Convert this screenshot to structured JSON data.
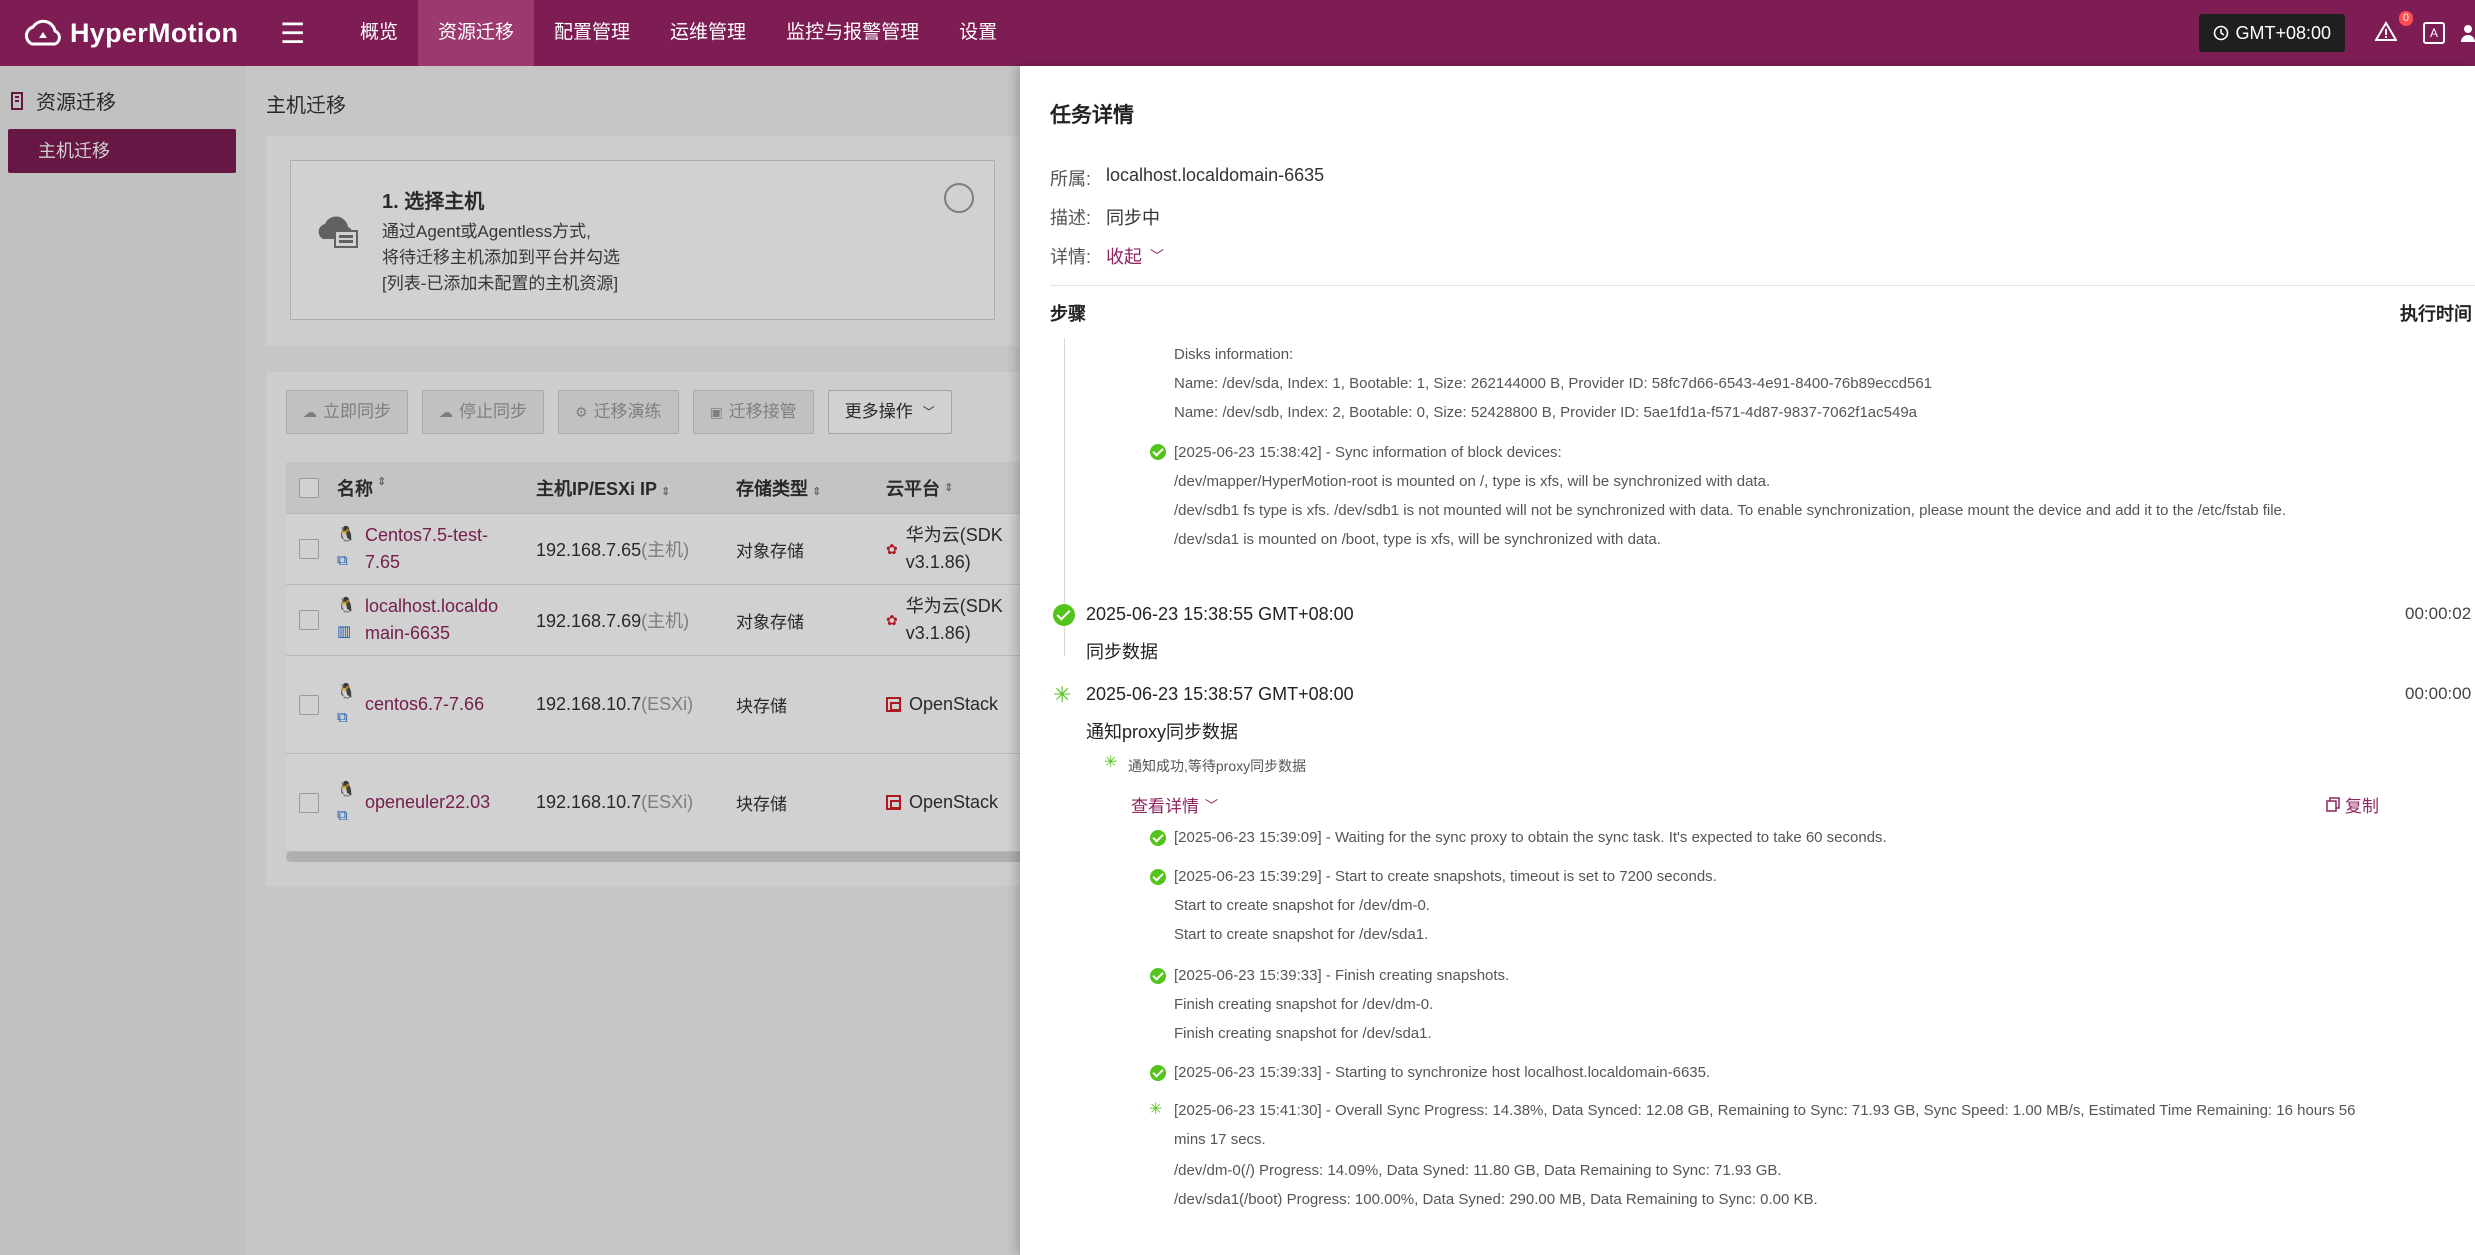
{
  "brand": {
    "name": "HyperMotion",
    "accent": "#7e1d54"
  },
  "nav": {
    "items": [
      "概览",
      "资源迁移",
      "配置管理",
      "运维管理",
      "监控与报警管理",
      "设置"
    ],
    "active": "资源迁移",
    "timezone": "GMT+08:00",
    "alert_count": "0"
  },
  "sidebar": {
    "title": "资源迁移",
    "items": [
      "主机迁移"
    ]
  },
  "page": {
    "title": "主机迁移"
  },
  "step_card": {
    "name": "1. 选择主机",
    "lines": [
      "通过Agent或Agentless方式,",
      "将待迁移主机添加到平台并勾选",
      "[列表-已添加未配置的主机资源]"
    ]
  },
  "toolbar": {
    "sync_now": "立即同步",
    "stop_sync": "停止同步",
    "drill": "迁移演练",
    "takeover": "迁移接管",
    "more": "更多操作"
  },
  "table": {
    "headers": [
      "名称",
      "主机IP/ESXi IP",
      "存储类型",
      "云平台"
    ],
    "rows": [
      {
        "name_1": "Centos7.5-test-",
        "name_2": "7.65",
        "ip": "192.168.7.65",
        "ip_type": "(主机)",
        "storage": "对象存储",
        "cloud_1": "华为云(SDK",
        "cloud_2": "v3.1.86)"
      },
      {
        "name_1": "localhost.localdo",
        "name_2": "main-6635",
        "ip": "192.168.7.69",
        "ip_type": "(主机)",
        "storage": "对象存储",
        "cloud_1": "华为云(SDK",
        "cloud_2": "v3.1.86)"
      },
      {
        "name_1": "centos6.7-7.66",
        "name_2": "",
        "ip": "192.168.10.7",
        "ip_type": "(ESXi)",
        "storage": "块存储",
        "cloud_1": "OpenStack",
        "cloud_2": ""
      },
      {
        "name_1": "openeuler22.03",
        "name_2": "",
        "ip": "192.168.10.7",
        "ip_type": "(ESXi)",
        "storage": "块存储",
        "cloud_1": "OpenStack",
        "cloud_2": ""
      }
    ]
  },
  "drawer": {
    "title": "任务详情",
    "owner_label": "所属:",
    "owner": "localhost.localdomain-6635",
    "desc_label": "描述:",
    "desc": "同步中",
    "detail_label": "详情:",
    "collapse": "收起",
    "steps_header": "步骤",
    "time_header": "执行时间",
    "logs_top": [
      "Disks information:",
      "Name: /dev/sda, Index: 1, Bootable: 1, Size: 262144000 B, Provider ID: 58fc7d66-6543-4e91-8400-76b89eccd561",
      "Name: /dev/sdb, Index: 2, Bootable: 0, Size: 52428800 B, Provider ID: 5ae1fd1a-f571-4d87-9837-7062f1ac549a",
      "[2025-06-23 15:38:42] - Sync information of block devices:",
      "/dev/mapper/HyperMotion-root is mounted on /, type is xfs, will be synchronized with data.",
      "/dev/sdb1 fs type is xfs. /dev/sdb1 is not mounted will not be synchronized with data. To enable synchronization, please mount the device and add it to the /etc/fstab file.",
      "/dev/sda1 is mounted on /boot, type is xfs, will be synchronized with data."
    ],
    "step_sync": {
      "time": "2025-06-23 15:38:55 GMT+08:00",
      "label": "同步数据",
      "duration": "00:00:02"
    },
    "step_proxy": {
      "time": "2025-06-23 15:38:57 GMT+08:00",
      "label": "通知proxy同步数据",
      "duration": "00:00:00",
      "note": "通知成功,等待proxy同步数据"
    },
    "view_detail": "查看详情",
    "copy": "复制",
    "logs_bottom": [
      "[2025-06-23 15:39:09] - Waiting for the sync proxy to obtain the sync task. It's expected to take 60 seconds.",
      "[2025-06-23 15:39:29] - Start to create snapshots, timeout is set to 7200 seconds.",
      "Start to create snapshot for /dev/dm-0.",
      "Start to create snapshot for /dev/sda1.",
      "[2025-06-23 15:39:33] - Finish creating snapshots.",
      "Finish creating snapshot for /dev/dm-0.",
      "Finish creating snapshot for /dev/sda1.",
      "[2025-06-23 15:39:33] - Starting to synchronize host localhost.localdomain-6635.",
      "[2025-06-23 15:41:30] - Overall Sync Progress: 14.38%, Data Synced: 12.08 GB, Remaining to Sync: 71.93 GB, Sync Speed: 1.00 MB/s, Estimated Time Remaining: 16 hours 56 mins 17 secs.",
      "/dev/dm-0(/) Progress: 14.09%, Data Syned: 11.80 GB, Data Remaining to Sync: 71.93 GB.",
      "/dev/sda1(/boot) Progress: 100.00%, Data Syned: 290.00 MB, Data Remaining to Sync: 0.00 KB."
    ]
  }
}
